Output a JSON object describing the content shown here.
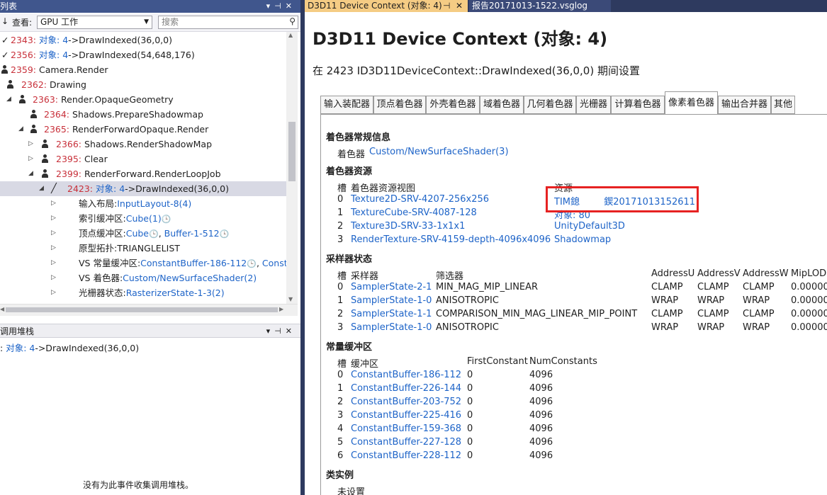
{
  "left_panel": {
    "title": "列表",
    "view_label": "查看:",
    "view_value": "GPU 工作",
    "search_placeholder": "搜索",
    "items": [
      {
        "num": "2343:",
        "obj": "对象: 4",
        "text": "->DrawIndexed(36,0,0)"
      },
      {
        "num": "2356:",
        "obj": "对象: 4",
        "text": "->DrawIndexed(54,648,176)"
      },
      {
        "num": "2359:",
        "text": "Camera.Render"
      },
      {
        "num": "2362:",
        "text": "Drawing"
      },
      {
        "num": "2363:",
        "text": "Render.OpaqueGeometry"
      },
      {
        "num": "2364:",
        "text": "Shadows.PrepareShadowmap"
      },
      {
        "num": "2365:",
        "text": "RenderForwardOpaque.Render"
      },
      {
        "num": "2366:",
        "text": "Shadows.RenderShadowMap"
      },
      {
        "num": "2395:",
        "text": "Clear"
      },
      {
        "num": "2399:",
        "text": "RenderForward.RenderLoopJob"
      },
      {
        "num": "2423:",
        "obj": "对象: 4",
        "text": "->DrawIndexed(36,0,0)"
      }
    ],
    "props": [
      {
        "label": "输入布局:",
        "link": "InputLayout-8(4)"
      },
      {
        "label": "索引缓冲区:",
        "link": "Cube(1)"
      },
      {
        "label": "顶点缓冲区:",
        "link": "Cube",
        "link2": "Buffer-1-512"
      },
      {
        "label": "原型拓扑:",
        "text": "TRIANGLELIST"
      },
      {
        "label": "VS 常量缓冲区:",
        "link": "ConstantBuffer-186-112",
        "link2": "Constan"
      },
      {
        "label": "VS 着色器:",
        "link": "Custom/NewSurfaceShader(2)"
      },
      {
        "label": "光栅器状态:",
        "link": "RasterizerState-1-3(2)"
      }
    ]
  },
  "call_stack": {
    "title": "调用堆栈",
    "entry_obj": "对象: 4",
    "entry_text": "->DrawIndexed(36,0,0)",
    "empty_msg": "没有为此事件收集调用堆栈。"
  },
  "doc_tabs": {
    "active": "D3D11 Device Context (对象: 4)",
    "pin": "⊣",
    "close": "✕",
    "inactive": "报告20171013-1522.vsglog"
  },
  "main": {
    "title": "D3D11 Device Context (对象: 4)",
    "subtitle": "在 2423 ID3D11DeviceContext::DrawIndexed(36,0,0) 期间设置",
    "tabs": [
      "输入装配器",
      "顶点着色器",
      "外壳着色器",
      "域着色器",
      "几何着色器",
      "光栅器",
      "计算着色器",
      "像素着色器",
      "输出合并器",
      "其他"
    ],
    "shader_general_title": "着色器常规信息",
    "shader_label": "着色器",
    "shader_value": "Custom/NewSurfaceShader(3)",
    "resources_title": "着色器资源",
    "res_headers": [
      "槽",
      "着色器资源视图",
      "资源"
    ],
    "resources": [
      {
        "slot": "0",
        "view": "Texture2D-SRV-4207-256x256",
        "res": "TIM鎴　 　 鍥20171013152611"
      },
      {
        "slot": "1",
        "view": "TextureCube-SRV-4087-128",
        "res": "对象: 80"
      },
      {
        "slot": "2",
        "view": "Texture3D-SRV-33-1x1x1",
        "res": "UnityDefault3D"
      },
      {
        "slot": "3",
        "view": "RenderTexture-SRV-4159-depth-4096x4096",
        "res": "Shadowmap"
      }
    ],
    "sampler_title": "采样器状态",
    "sampler_headers": [
      "槽",
      "采样器",
      "筛选器",
      "AddressU",
      "AddressV",
      "AddressW",
      "MipLOD"
    ],
    "samplers": [
      {
        "slot": "0",
        "name": "SamplerState-2-1",
        "filter": "MIN_MAG_MIP_LINEAR",
        "u": "CLAMP",
        "v": "CLAMP",
        "w": "CLAMP",
        "mip": "0.00000"
      },
      {
        "slot": "1",
        "name": "SamplerState-1-0",
        "filter": "ANISOTROPIC",
        "u": "WRAP",
        "v": "WRAP",
        "w": "WRAP",
        "mip": "0.00000"
      },
      {
        "slot": "2",
        "name": "SamplerState-1-1",
        "filter": "COMPARISON_MIN_MAG_LINEAR_MIP_POINT",
        "u": "CLAMP",
        "v": "CLAMP",
        "w": "CLAMP",
        "mip": "0.00000"
      },
      {
        "slot": "3",
        "name": "SamplerState-1-0",
        "filter": "ANISOTROPIC",
        "u": "WRAP",
        "v": "WRAP",
        "w": "WRAP",
        "mip": "0.00000"
      }
    ],
    "cb_title": "常量缓冲区",
    "cb_headers": [
      "槽",
      "缓冲区",
      "FirstConstant",
      "NumConstants"
    ],
    "cbuffers": [
      {
        "slot": "0",
        "name": "ConstantBuffer-186-112",
        "first": "0",
        "num": "4096"
      },
      {
        "slot": "1",
        "name": "ConstantBuffer-226-144",
        "first": "0",
        "num": "4096"
      },
      {
        "slot": "2",
        "name": "ConstantBuffer-203-752",
        "first": "0",
        "num": "4096"
      },
      {
        "slot": "3",
        "name": "ConstantBuffer-225-416",
        "first": "0",
        "num": "4096"
      },
      {
        "slot": "4",
        "name": "ConstantBuffer-159-368",
        "first": "0",
        "num": "4096"
      },
      {
        "slot": "5",
        "name": "ConstantBuffer-227-128",
        "first": "0",
        "num": "4096"
      },
      {
        "slot": "6",
        "name": "ConstantBuffer-228-112",
        "first": "0",
        "num": "4096"
      }
    ],
    "class_title": "类实例",
    "class_value": "未设置"
  },
  "colors": {
    "highlight_box": "#e62222",
    "link": "#1e64c8",
    "event_number": "#c8303a",
    "active_tab": "#f5cc84"
  }
}
